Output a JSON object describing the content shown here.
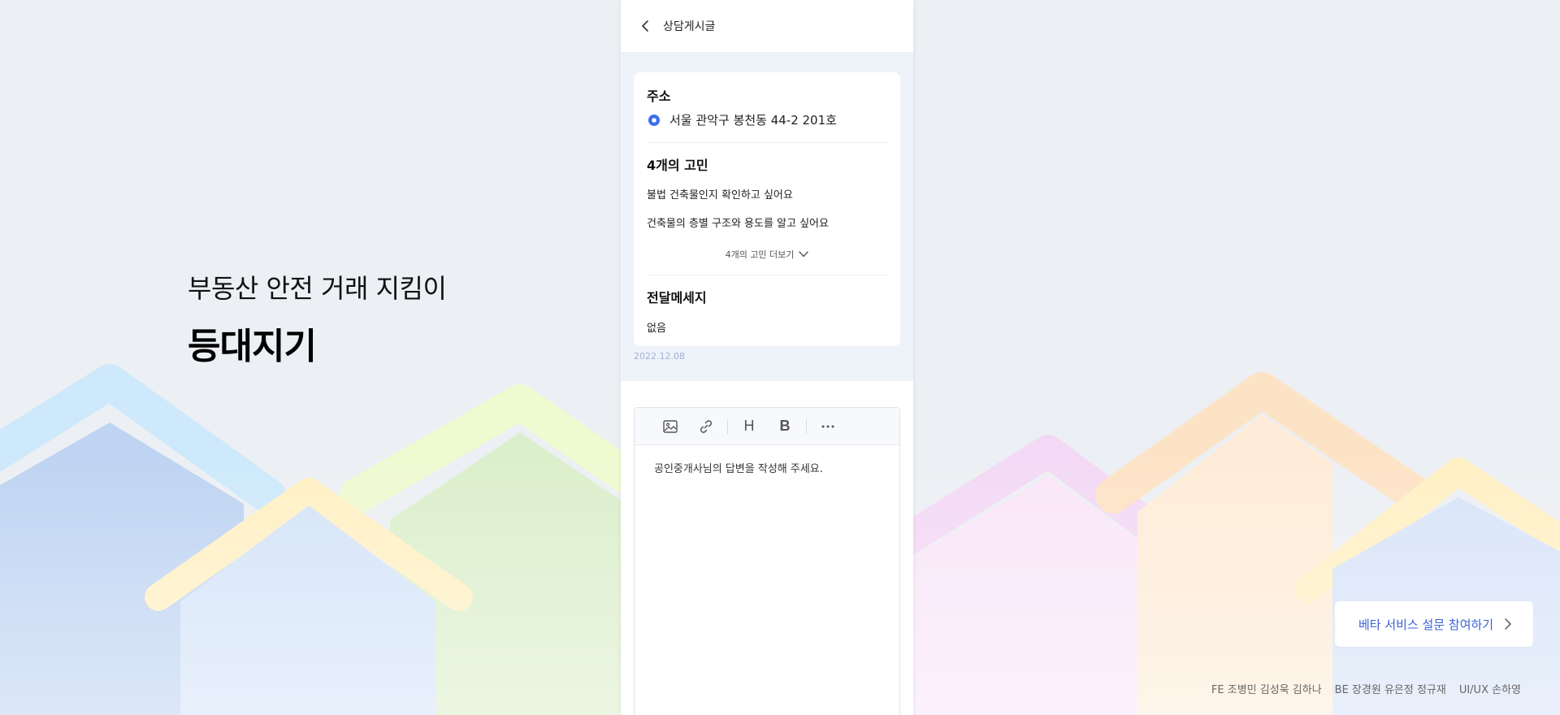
{
  "hero": {
    "subtitle": "부동산 안전 거래 지킴이",
    "title": "등대지기"
  },
  "appbar": {
    "title": "상담게시글"
  },
  "card": {
    "address_title": "주소",
    "address": "서울 관악구 봉천동 44-2 201호",
    "worries_title": "4개의 고민",
    "worries": [
      "불법 건축물인지 확인하고 싶어요",
      "건축물의 층별 구조와 용도를 알고 싶어요"
    ],
    "more_label": "4개의 고민 더보기",
    "message_title": "전달메세지",
    "message": "없음"
  },
  "date": "2022.12.08",
  "editor": {
    "placeholder": "공인중개사님의 답변을 작성해 주세요.",
    "toolbar": {
      "heading_label": "H",
      "bold_label": "B"
    }
  },
  "cta": {
    "label": "베타 서비스 설문 참여하기"
  },
  "credits": [
    "FE 조병민 김성욱 김하나",
    "BE 장경원 유은정 정규재",
    "UI/UX 손하영"
  ],
  "colors": {
    "accent": "#3d63d8",
    "pin": "#3b6ef0",
    "background": "#eceff3"
  },
  "icons": {
    "back": "chevron-left-icon",
    "pin": "location-pin-icon",
    "more": "chevron-down-icon",
    "image": "image-icon",
    "link": "link-icon",
    "overflow": "more-horizontal-icon",
    "cta": "chevron-right-icon"
  }
}
